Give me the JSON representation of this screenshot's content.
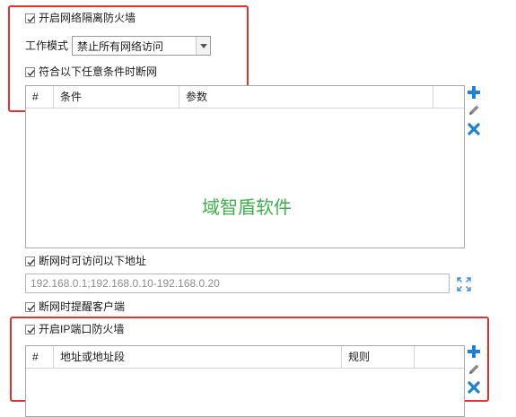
{
  "firewall": {
    "enable_label": "开启网络隔离防火墙",
    "mode_label": "工作模式",
    "mode_value": "禁止所有网络访问",
    "cond_label": "符合以下任意条件时断网",
    "columns": [
      "#",
      "条件",
      "参数"
    ],
    "watermark": "域智盾软件"
  },
  "access": {
    "label": "断网时可访问以下地址",
    "value": "192.168.0.1;192.168.0.10-192.168.0.20"
  },
  "remind": {
    "label": "断网时提醒客户端"
  },
  "ipport": {
    "enable_label": "开启IP端口防火墙",
    "columns": [
      "#",
      "地址或地址段",
      "规则"
    ]
  },
  "icons": {
    "add": "plus-icon",
    "edit": "pencil-icon",
    "delete": "x-icon",
    "expand": "expand-icon"
  },
  "colors": {
    "accent": "#1e7fd6",
    "highlight": "#e0322f",
    "watermark": "#3bb24a"
  }
}
